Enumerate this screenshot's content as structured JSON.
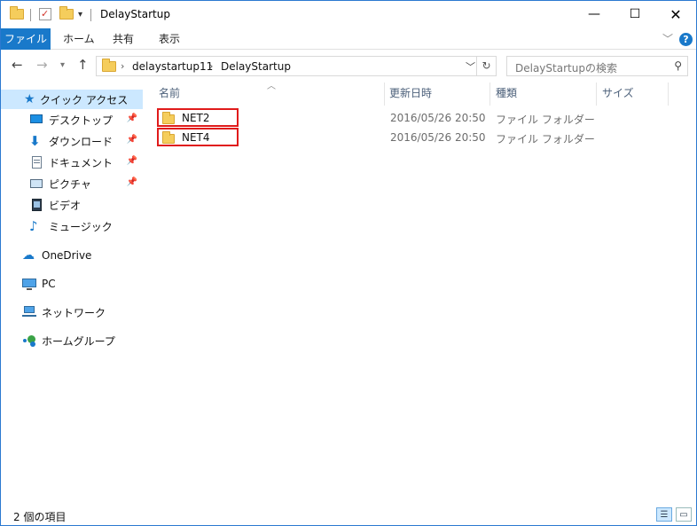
{
  "window": {
    "title": "DelayStartup"
  },
  "ribbon": {
    "tabs": [
      "ファイル",
      "ホーム",
      "共有",
      "表示"
    ],
    "help_glyph": "?"
  },
  "address": {
    "crumbs": [
      "delaystartup11",
      "DelayStartup"
    ]
  },
  "search": {
    "placeholder": "DelayStartupの検索"
  },
  "nav": {
    "quick_access": "クイック アクセス",
    "items": [
      {
        "label": "デスクトップ",
        "icon": "desktop-icon",
        "pinned": true
      },
      {
        "label": "ダウンロード",
        "icon": "download-icon",
        "pinned": true
      },
      {
        "label": "ドキュメント",
        "icon": "document-icon",
        "pinned": true
      },
      {
        "label": "ピクチャ",
        "icon": "pictures-icon",
        "pinned": true
      },
      {
        "label": "ビデオ",
        "icon": "video-icon",
        "pinned": false
      },
      {
        "label": "ミュージック",
        "icon": "music-icon",
        "pinned": false
      }
    ],
    "roots": [
      {
        "label": "OneDrive",
        "icon": "onedrive-icon"
      },
      {
        "label": "PC",
        "icon": "pc-icon"
      },
      {
        "label": "ネットワーク",
        "icon": "network-icon"
      },
      {
        "label": "ホームグループ",
        "icon": "homegroup-icon"
      }
    ]
  },
  "columns": {
    "name": "名前",
    "date": "更新日時",
    "type": "種類",
    "size": "サイズ"
  },
  "files": [
    {
      "name": "NET2",
      "date": "2016/05/26 20:50",
      "type": "ファイル フォルダー",
      "size": ""
    },
    {
      "name": "NET4",
      "date": "2016/05/26 20:50",
      "type": "ファイル フォルダー",
      "size": ""
    }
  ],
  "status": {
    "count": "2 個の項目"
  },
  "colors": {
    "accent": "#1979ca",
    "selected": "#cce8ff",
    "highlight_box": "#e01b1b"
  }
}
